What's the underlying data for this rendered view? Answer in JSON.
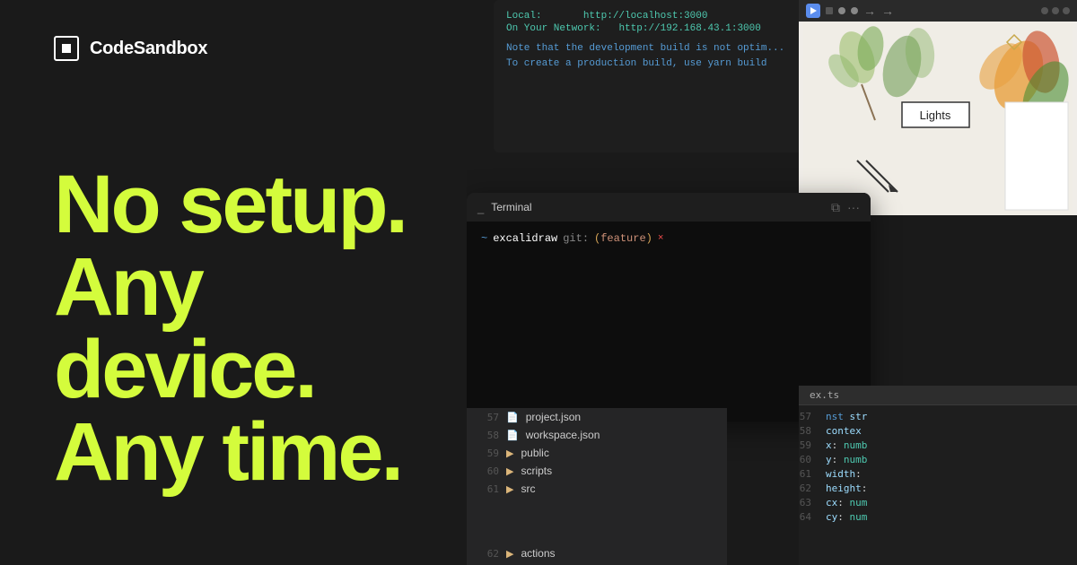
{
  "logo": {
    "name": "CodeSandbox",
    "label": "CodeSandbox"
  },
  "headline": {
    "line1": "No setup.",
    "line2": "Any device.",
    "line3": "Any time."
  },
  "terminal_top": {
    "line1_label": "Local:",
    "line1_value": "http://localhost:3000",
    "line2_label": "On Your Network:",
    "line2_value": "http://192.168.43.1:3000",
    "warn1": "Note that the development build is not optim...",
    "warn2": "To create a production build, use ",
    "warn2_code": "yarn build"
  },
  "terminal_main": {
    "title": "Terminal",
    "path": "excalidraw",
    "branch_label": "git:",
    "branch_name": "feature",
    "x_label": "×"
  },
  "design": {
    "lights_label": "Lights"
  },
  "file_tree": {
    "items": [
      {
        "linenum": "57",
        "type": "file",
        "name": "project.json"
      },
      {
        "linenum": "58",
        "type": "file",
        "name": "workspace.json"
      },
      {
        "linenum": "59",
        "type": "folder",
        "name": "public"
      },
      {
        "linenum": "60",
        "type": "folder",
        "name": "scripts"
      },
      {
        "linenum": "61",
        "type": "folder",
        "name": "src"
      },
      {
        "linenum": "62",
        "type": "folder",
        "name": "actions"
      }
    ]
  },
  "code": {
    "filename": "ex.ts",
    "lines": [
      {
        "num": "57",
        "content": "nst str"
      },
      {
        "num": "58",
        "content": "contex"
      },
      {
        "num": "59",
        "keyword": "x:",
        "type": "numb"
      },
      {
        "num": "60",
        "keyword": "y:",
        "type": "numb"
      },
      {
        "num": "61",
        "keyword": "width:",
        "type": ""
      },
      {
        "num": "62",
        "keyword": "height:",
        "type": ""
      },
      {
        "num": "63",
        "keyword": "cx:",
        "type": "num"
      },
      {
        "num": "64",
        "keyword": "cy:",
        "type": "num"
      }
    ]
  },
  "actions_label": "actions"
}
